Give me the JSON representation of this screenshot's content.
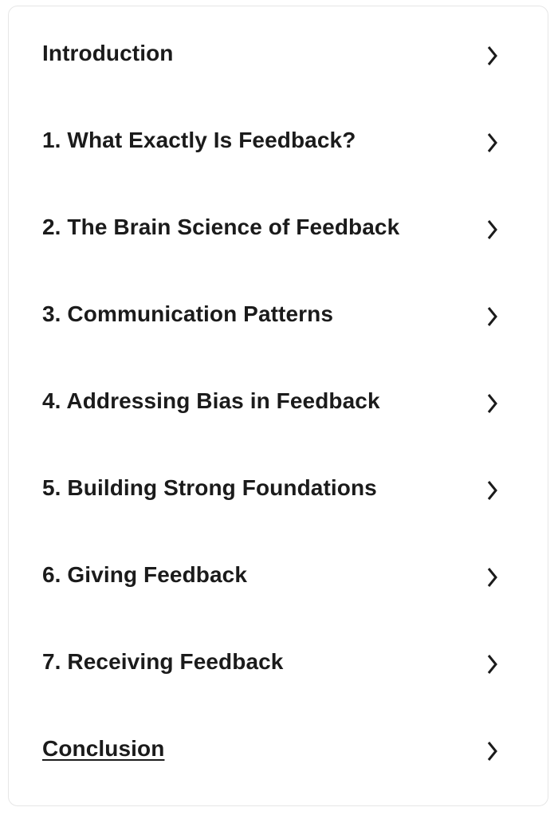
{
  "toc": {
    "items": [
      {
        "label": "Introduction",
        "icon": "chevron-right-icon",
        "active": false
      },
      {
        "label": "1. What Exactly Is Feedback?",
        "icon": "chevron-right-icon",
        "active": false
      },
      {
        "label": "2. The Brain Science of Feedback",
        "icon": "chevron-right-icon",
        "active": false
      },
      {
        "label": "3. Communication Patterns",
        "icon": "chevron-right-icon",
        "active": false
      },
      {
        "label": "4. Addressing Bias in Feedback",
        "icon": "chevron-right-icon",
        "active": false
      },
      {
        "label": "5. Building Strong Foundations",
        "icon": "chevron-right-icon",
        "active": false
      },
      {
        "label": "6. Giving Feedback",
        "icon": "chevron-right-icon",
        "active": false
      },
      {
        "label": "7. Receiving Feedback",
        "icon": "chevron-right-icon",
        "active": false
      },
      {
        "label": "Conclusion",
        "icon": "chevron-right-icon",
        "active": true
      }
    ]
  }
}
